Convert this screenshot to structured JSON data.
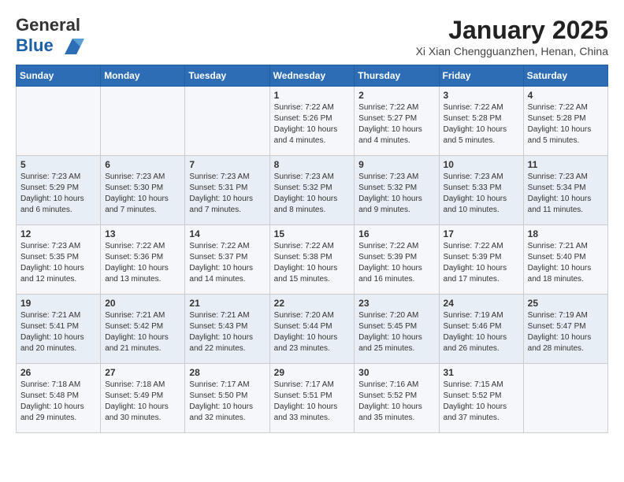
{
  "header": {
    "logo_line1": "General",
    "logo_line2": "Blue",
    "month": "January 2025",
    "location": "Xi Xian Chengguanzhen, Henan, China"
  },
  "weekdays": [
    "Sunday",
    "Monday",
    "Tuesday",
    "Wednesday",
    "Thursday",
    "Friday",
    "Saturday"
  ],
  "weeks": [
    [
      {
        "day": "",
        "info": ""
      },
      {
        "day": "",
        "info": ""
      },
      {
        "day": "",
        "info": ""
      },
      {
        "day": "1",
        "info": "Sunrise: 7:22 AM\nSunset: 5:26 PM\nDaylight: 10 hours\nand 4 minutes."
      },
      {
        "day": "2",
        "info": "Sunrise: 7:22 AM\nSunset: 5:27 PM\nDaylight: 10 hours\nand 4 minutes."
      },
      {
        "day": "3",
        "info": "Sunrise: 7:22 AM\nSunset: 5:28 PM\nDaylight: 10 hours\nand 5 minutes."
      },
      {
        "day": "4",
        "info": "Sunrise: 7:22 AM\nSunset: 5:28 PM\nDaylight: 10 hours\nand 5 minutes."
      }
    ],
    [
      {
        "day": "5",
        "info": "Sunrise: 7:23 AM\nSunset: 5:29 PM\nDaylight: 10 hours\nand 6 minutes."
      },
      {
        "day": "6",
        "info": "Sunrise: 7:23 AM\nSunset: 5:30 PM\nDaylight: 10 hours\nand 7 minutes."
      },
      {
        "day": "7",
        "info": "Sunrise: 7:23 AM\nSunset: 5:31 PM\nDaylight: 10 hours\nand 7 minutes."
      },
      {
        "day": "8",
        "info": "Sunrise: 7:23 AM\nSunset: 5:32 PM\nDaylight: 10 hours\nand 8 minutes."
      },
      {
        "day": "9",
        "info": "Sunrise: 7:23 AM\nSunset: 5:32 PM\nDaylight: 10 hours\nand 9 minutes."
      },
      {
        "day": "10",
        "info": "Sunrise: 7:23 AM\nSunset: 5:33 PM\nDaylight: 10 hours\nand 10 minutes."
      },
      {
        "day": "11",
        "info": "Sunrise: 7:23 AM\nSunset: 5:34 PM\nDaylight: 10 hours\nand 11 minutes."
      }
    ],
    [
      {
        "day": "12",
        "info": "Sunrise: 7:23 AM\nSunset: 5:35 PM\nDaylight: 10 hours\nand 12 minutes."
      },
      {
        "day": "13",
        "info": "Sunrise: 7:22 AM\nSunset: 5:36 PM\nDaylight: 10 hours\nand 13 minutes."
      },
      {
        "day": "14",
        "info": "Sunrise: 7:22 AM\nSunset: 5:37 PM\nDaylight: 10 hours\nand 14 minutes."
      },
      {
        "day": "15",
        "info": "Sunrise: 7:22 AM\nSunset: 5:38 PM\nDaylight: 10 hours\nand 15 minutes."
      },
      {
        "day": "16",
        "info": "Sunrise: 7:22 AM\nSunset: 5:39 PM\nDaylight: 10 hours\nand 16 minutes."
      },
      {
        "day": "17",
        "info": "Sunrise: 7:22 AM\nSunset: 5:39 PM\nDaylight: 10 hours\nand 17 minutes."
      },
      {
        "day": "18",
        "info": "Sunrise: 7:21 AM\nSunset: 5:40 PM\nDaylight: 10 hours\nand 18 minutes."
      }
    ],
    [
      {
        "day": "19",
        "info": "Sunrise: 7:21 AM\nSunset: 5:41 PM\nDaylight: 10 hours\nand 20 minutes."
      },
      {
        "day": "20",
        "info": "Sunrise: 7:21 AM\nSunset: 5:42 PM\nDaylight: 10 hours\nand 21 minutes."
      },
      {
        "day": "21",
        "info": "Sunrise: 7:21 AM\nSunset: 5:43 PM\nDaylight: 10 hours\nand 22 minutes."
      },
      {
        "day": "22",
        "info": "Sunrise: 7:20 AM\nSunset: 5:44 PM\nDaylight: 10 hours\nand 23 minutes."
      },
      {
        "day": "23",
        "info": "Sunrise: 7:20 AM\nSunset: 5:45 PM\nDaylight: 10 hours\nand 25 minutes."
      },
      {
        "day": "24",
        "info": "Sunrise: 7:19 AM\nSunset: 5:46 PM\nDaylight: 10 hours\nand 26 minutes."
      },
      {
        "day": "25",
        "info": "Sunrise: 7:19 AM\nSunset: 5:47 PM\nDaylight: 10 hours\nand 28 minutes."
      }
    ],
    [
      {
        "day": "26",
        "info": "Sunrise: 7:18 AM\nSunset: 5:48 PM\nDaylight: 10 hours\nand 29 minutes."
      },
      {
        "day": "27",
        "info": "Sunrise: 7:18 AM\nSunset: 5:49 PM\nDaylight: 10 hours\nand 30 minutes."
      },
      {
        "day": "28",
        "info": "Sunrise: 7:17 AM\nSunset: 5:50 PM\nDaylight: 10 hours\nand 32 minutes."
      },
      {
        "day": "29",
        "info": "Sunrise: 7:17 AM\nSunset: 5:51 PM\nDaylight: 10 hours\nand 33 minutes."
      },
      {
        "day": "30",
        "info": "Sunrise: 7:16 AM\nSunset: 5:52 PM\nDaylight: 10 hours\nand 35 minutes."
      },
      {
        "day": "31",
        "info": "Sunrise: 7:15 AM\nSunset: 5:52 PM\nDaylight: 10 hours\nand 37 minutes."
      },
      {
        "day": "",
        "info": ""
      }
    ]
  ]
}
